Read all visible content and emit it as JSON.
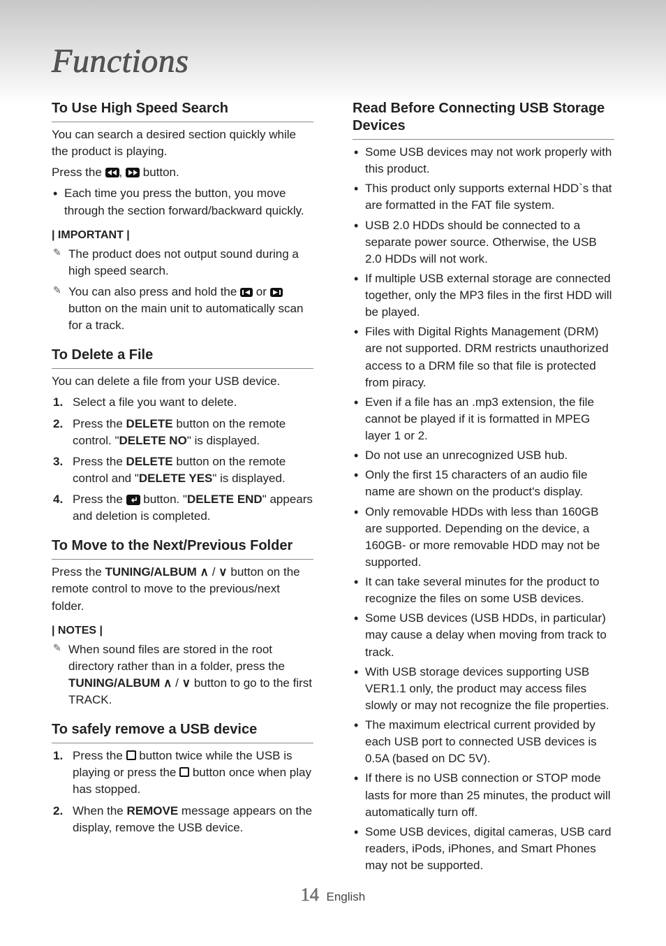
{
  "page": {
    "title": "Functions",
    "number": "14",
    "lang": "English"
  },
  "left": {
    "s1": {
      "head": "To Use High Speed Search",
      "p1": "You can search a desired section quickly while the product is playing.",
      "p2a": "Press the ",
      "p2b": ", ",
      "p2c": " button.",
      "b1": "Each time you press the button, you move through the section forward/backward quickly.",
      "callout": "| IMPORTANT |",
      "n1": "The product does not output sound during a high speed search.",
      "n2a": "You can also press and hold the ",
      "n2b": " or ",
      "n2c": " button on the main unit to automatically scan for a track."
    },
    "s2": {
      "head": "To Delete a File",
      "p1": "You can delete a file from your USB device.",
      "o1": "Select a file you want to delete.",
      "o2a": "Press the ",
      "o2b": "DELETE",
      "o2c": " button on the remote control. \"",
      "o2d": "DELETE NO",
      "o2e": "\" is displayed.",
      "o3a": "Press the ",
      "o3b": "DELETE",
      "o3c": " button on the remote control and \"",
      "o3d": "DELETE YES",
      "o3e": "\" is displayed.",
      "o4a": "Press the ",
      "o4b": " button. \"",
      "o4c": "DELETE END",
      "o4d": "\" appears and deletion is completed."
    },
    "s3": {
      "head": "To Move to the Next/Previous Folder",
      "p1a": "Press the ",
      "p1b": "TUNING/ALBUM",
      "p1c": " button on the remote control to move to the previous/next folder.",
      "callout": "| NOTES |",
      "n1a": "When sound files are stored in the root directory rather than in a folder, press the ",
      "n1b": "TUNING/ALBUM",
      "n1c": " button to go to the first TRACK."
    },
    "s4": {
      "head": "To safely remove a USB device",
      "o1a": "Press the ",
      "o1b": " button twice while the USB is playing or press the ",
      "o1c": " button once when play has stopped.",
      "o2a": "When the ",
      "o2b": "REMOVE",
      "o2c": " message appears on the display, remove the USB device."
    }
  },
  "right": {
    "head": "Read Before Connecting USB Storage Devices",
    "items": [
      "Some USB devices may not work properly with this product.",
      "This product only supports external HDD`s that are formatted in the FAT file system.",
      "USB 2.0 HDDs should be connected to a separate power source. Otherwise, the USB 2.0 HDDs will not work.",
      "If multiple USB external storage are connected together, only the MP3 files in the first HDD will be played.",
      "Files with Digital Rights Management (DRM) are not supported. DRM restricts unauthorized access to a DRM file so that file is protected from piracy.",
      "Even if a file has an .mp3 extension, the file cannot be played if it is formatted in MPEG layer 1 or 2.",
      "Do not use an unrecognized USB hub.",
      "Only the first 15 characters of an audio file name are shown on the product's display.",
      "Only removable HDDs with less than 160GB are supported. Depending on the device, a 160GB- or more removable HDD may not be supported.",
      "It can take several minutes for the product to recognize the files on some USB devices.",
      "Some USB devices (USB HDDs, in particular) may cause a delay when moving from track to track.",
      "With USB storage devices supporting USB VER1.1 only, the product may access files slowly or may not recognize the file properties.",
      "The maximum electrical current provided by each USB port to connected USB devices is 0.5A (based on DC 5V).",
      "If there is no USB connection or STOP mode lasts for more than 25 minutes, the product will automatically turn off.",
      "Some USB devices, digital cameras, USB card readers, iPods, iPhones, and Smart Phones may not be supported."
    ]
  }
}
